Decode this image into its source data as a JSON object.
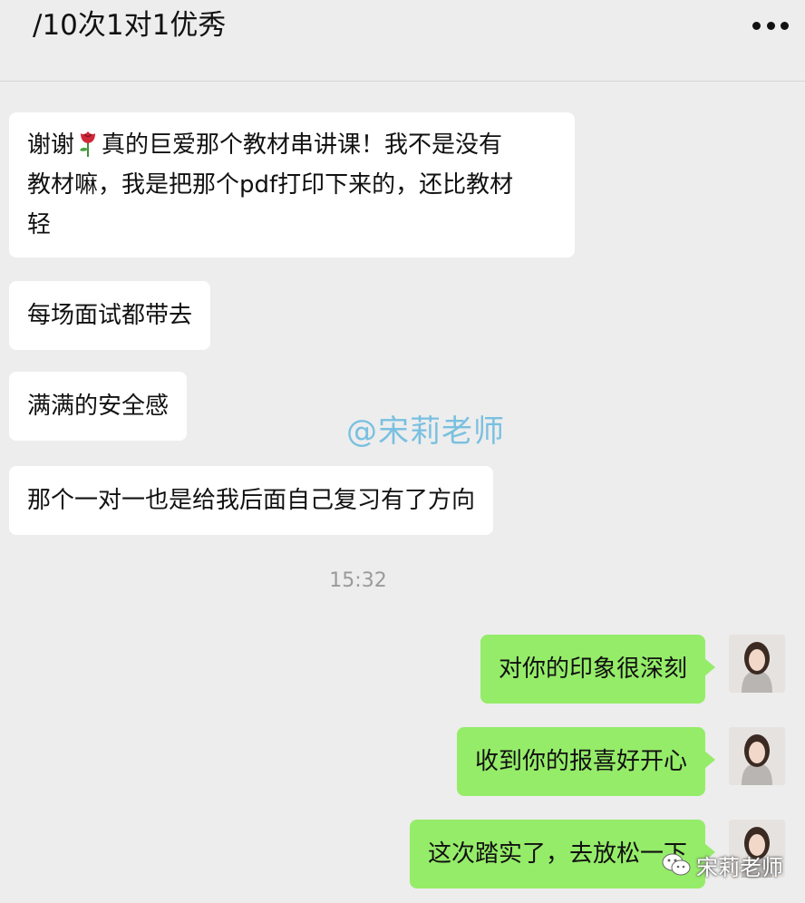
{
  "header": {
    "title": "/10次1对1优秀",
    "more_icon": "more-dots-icon"
  },
  "messages": [
    {
      "from": "other",
      "line1_before_emoji": "谢谢",
      "line1_after_emoji": "真的巨爱那个教材串讲课！我不是没有",
      "line2": "教材嘛，我是把那个pdf打印下来的，还比教材",
      "line3": "轻",
      "emoji": "rose-icon"
    },
    {
      "from": "other",
      "text": "每场面试都带去"
    },
    {
      "from": "other",
      "text": "满满的安全感"
    },
    {
      "from": "other",
      "text": "那个一对一也是给我后面自己复习有了方向"
    },
    {
      "from": "self",
      "text": "对你的印象很深刻"
    },
    {
      "from": "self",
      "text": "收到你的报喜好开心"
    },
    {
      "from": "self",
      "text": "这次踏实了，去放松一下"
    }
  ],
  "timestamp": "15:32",
  "watermarks": {
    "center": "@宋莉老师",
    "corner": "宋莉老师",
    "corner_icon": "wechat-icon"
  },
  "colors": {
    "background": "#ededed",
    "incoming_bubble": "#ffffff",
    "outgoing_bubble": "#95ec69",
    "watermark": "#7ac0e0"
  }
}
